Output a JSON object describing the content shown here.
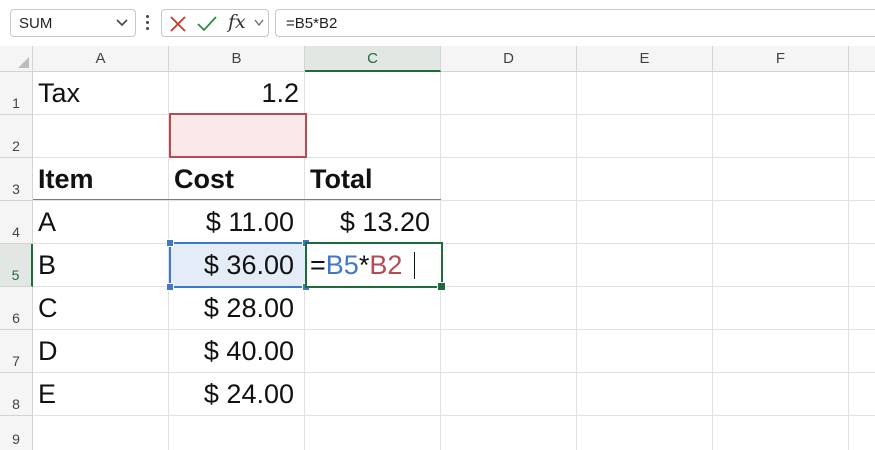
{
  "formula_bar": {
    "name_box": "SUM",
    "fx_label": "fx",
    "formula": "=B5*B2"
  },
  "columns": [
    "A",
    "B",
    "C",
    "D",
    "E",
    "F"
  ],
  "rows": [
    "1",
    "2",
    "3",
    "4",
    "5",
    "6",
    "7",
    "8",
    "9"
  ],
  "cells": {
    "A1": "Tax",
    "B1": "1.2",
    "A3": "Item",
    "B3": "Cost",
    "C3": "Total",
    "A4": "A",
    "B4": "$  11.00",
    "C4": "$  13.20",
    "A5": "B",
    "B5": "$  36.00",
    "A6": "C",
    "B6": "$  28.00",
    "A7": "D",
    "B7": "$  40.00",
    "A8": "E",
    "B8": "$  24.00"
  },
  "edit_cell": {
    "address": "C5",
    "eq": "=",
    "ref1": "B5",
    "op": "*",
    "ref2": "B2"
  },
  "colors": {
    "accent_green": "#1e6b3c",
    "ref_blue": "#3f78c6",
    "ref_red": "#b84a52"
  }
}
